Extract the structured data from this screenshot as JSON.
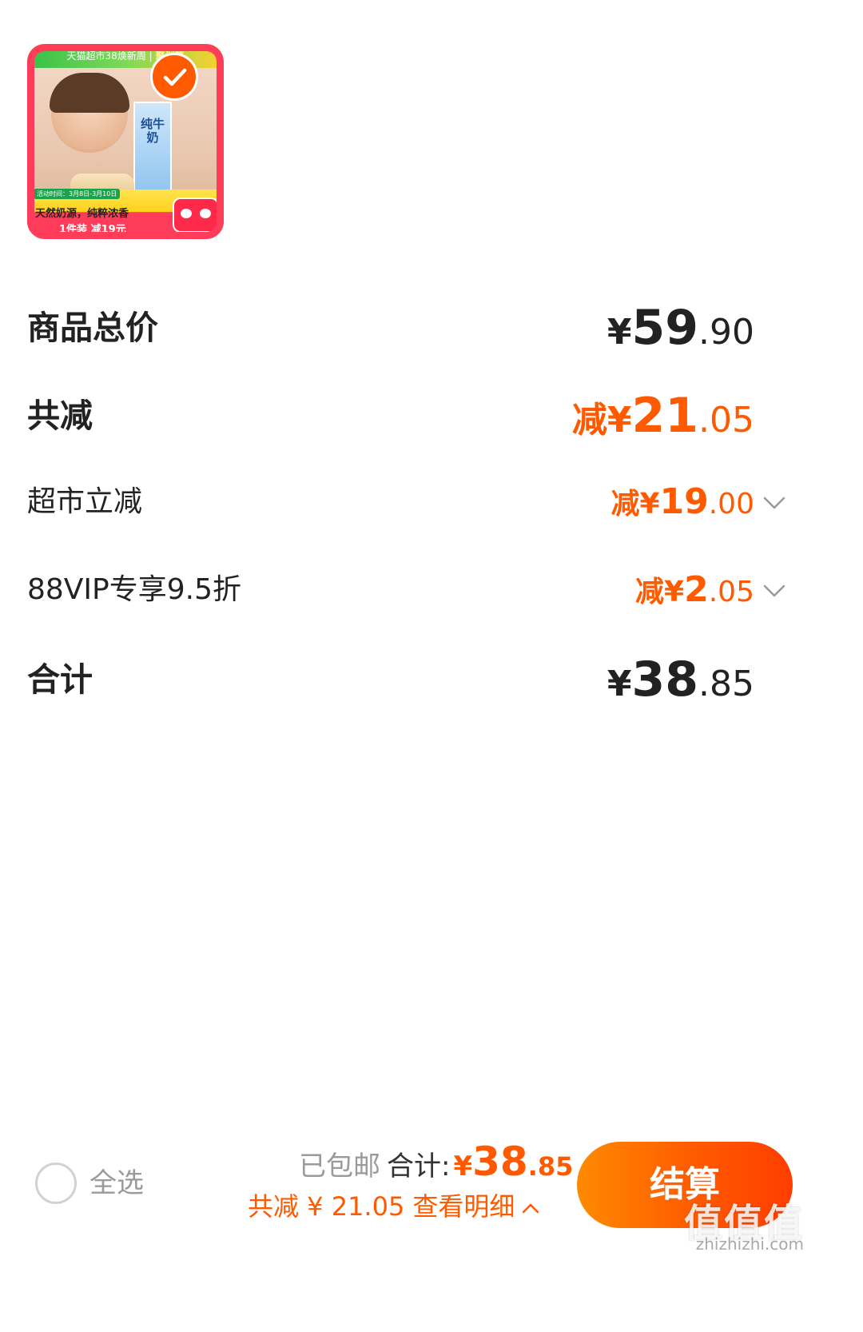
{
  "product": {
    "thumbnail": {
      "top_banner": "天猫超市38焕新周",
      "top_banner_tag": "聚划算",
      "carton_text": "纯牛奶",
      "activity_time": "活动时间：3月8日-3月10日",
      "slogan": "天然奶源，纯粹浓香",
      "promo": "1件装 减19元"
    },
    "selected": true
  },
  "summary": {
    "goods_total": {
      "label": "商品总价",
      "currency": "¥",
      "int": "59",
      "dec": ".90"
    },
    "total_discount": {
      "label": "共减",
      "prefix": "减¥",
      "int": "21",
      "dec": ".05"
    },
    "supermarket_discount": {
      "label": "超市立减",
      "prefix": "减¥",
      "int": "19",
      "dec": ".00"
    },
    "vip_discount": {
      "label": "88VIP专享9.5折",
      "prefix": "减¥",
      "int": "2",
      "dec": ".05"
    },
    "subtotal": {
      "label": "合计",
      "currency": "¥",
      "int": "38",
      "dec": ".85"
    }
  },
  "bottom_bar": {
    "select_all": "全选",
    "shipping": "已包邮",
    "total_label": "合计:",
    "total_currency": "¥",
    "total_int": "38",
    "total_dec": ".85",
    "discount_text": "共减 ¥ 21.05",
    "detail_link": "查看明细",
    "checkout": "结算"
  },
  "watermark": {
    "text": "值值值",
    "sub": "zhizhizhi.com"
  },
  "colors": {
    "accent": "#ff5a00",
    "text_dark": "#222222",
    "text_muted": "#9a9a9a"
  },
  "icons": {
    "check": "check-icon",
    "chevron_down": "chevron-down-icon",
    "chevron_up": "chevron-up-icon"
  }
}
